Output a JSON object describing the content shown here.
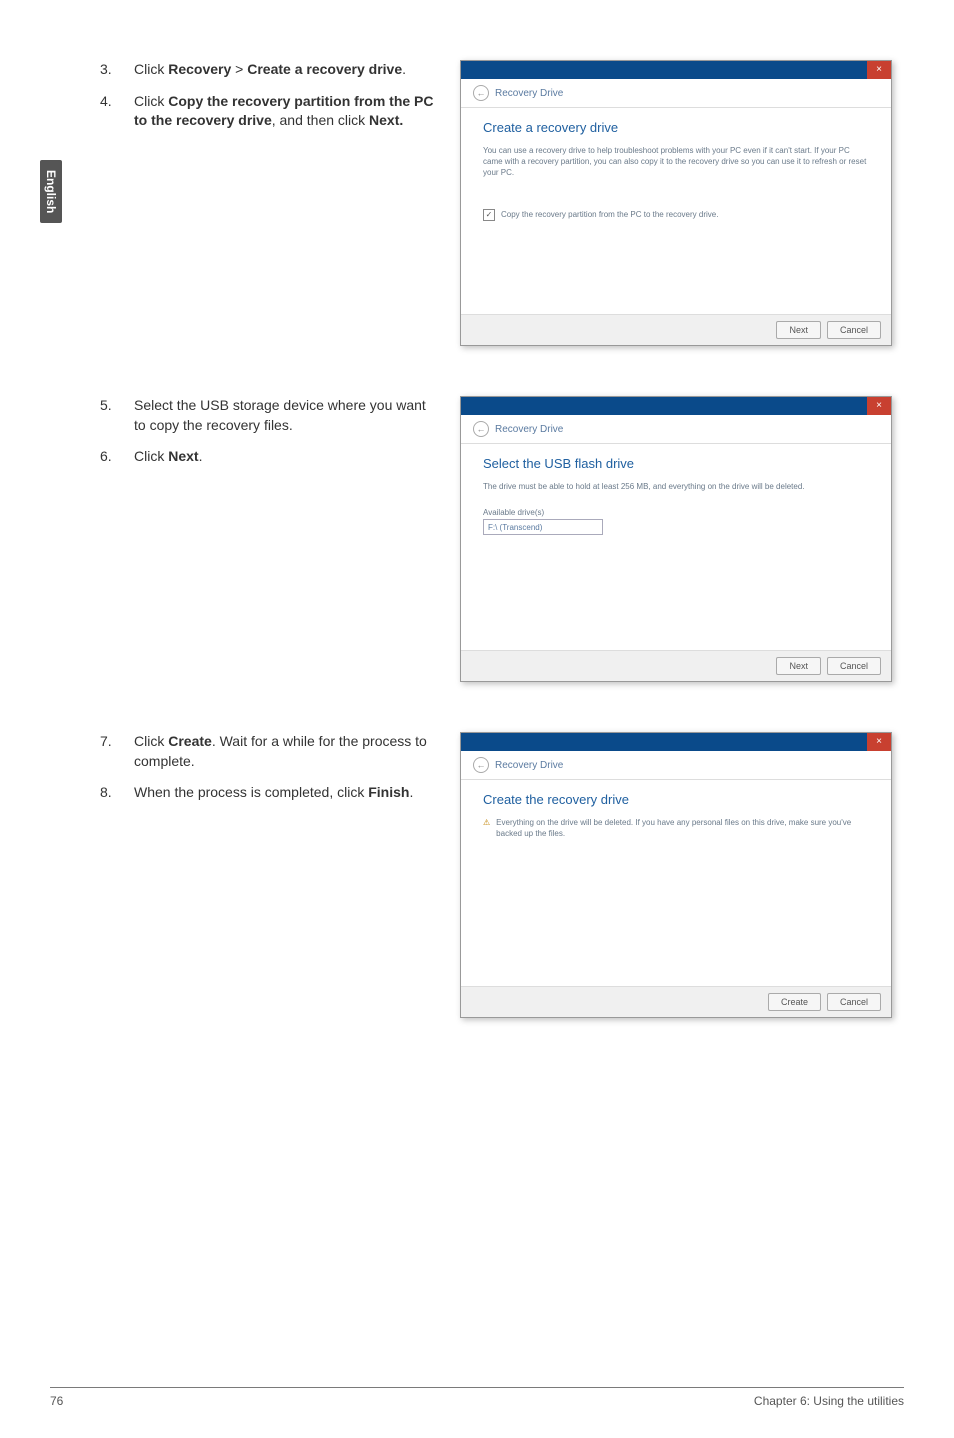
{
  "sideTab": "English",
  "section1": {
    "steps": [
      {
        "num": "3.",
        "prefix": "Click ",
        "bold": "Recovery",
        "gt": " > ",
        "bold2": "Create a recovery drive",
        "suffix": "."
      },
      {
        "num": "4.",
        "prefix": "Click ",
        "bold": "Copy the recovery partition from the PC to the recovery drive",
        "mid": ", and then click ",
        "bold2": "Next.",
        "suffix": ""
      }
    ],
    "dialog": {
      "breadcrumb_arrow": "←",
      "breadcrumb": "Recovery Drive",
      "title": "Create a recovery drive",
      "para": "You can use a recovery drive to help troubleshoot problems with your PC even if it can't start. If your PC came with a recovery partition, you can also copy it to the recovery drive so you can use it to refresh or reset your PC.",
      "checkbox_mark": "✓",
      "checkbox": "Copy the recovery partition from the PC to the recovery drive.",
      "btnNext": "Next",
      "btnCancel": "Cancel",
      "close": "×"
    }
  },
  "section2": {
    "steps": [
      {
        "num": "5.",
        "text": "Select the USB storage device where you want to copy the recovery files."
      },
      {
        "num": "6.",
        "prefix": "Click ",
        "bold": "Next",
        "suffix": "."
      }
    ],
    "dialog": {
      "breadcrumb_arrow": "←",
      "breadcrumb": "Recovery Drive",
      "title": "Select the USB flash drive",
      "para": "The drive must be able to hold at least 256 MB, and everything on the drive will be deleted.",
      "drvLabel": "Available drive(s)",
      "drvItem": "F:\\ (Transcend)",
      "btnNext": "Next",
      "btnCancel": "Cancel",
      "close": "×"
    }
  },
  "section3": {
    "steps": [
      {
        "num": "7.",
        "prefix": "Click ",
        "bold": "Create",
        "suffix": ". Wait for a while for the process to complete."
      },
      {
        "num": "8.",
        "prefix": "When the process is completed, click ",
        "bold": "Finish",
        "suffix": "."
      }
    ],
    "dialog": {
      "breadcrumb_arrow": "←",
      "breadcrumb": "Recovery Drive",
      "title": "Create the recovery drive",
      "warnIcon": "⚠",
      "para": "Everything on the drive will be deleted. If you have any personal files on this drive, make sure you've backed up the files.",
      "btnCreate": "Create",
      "btnCancel": "Cancel",
      "close": "×"
    }
  },
  "footer": {
    "pageNum": "76",
    "chapter": "Chapter 6: Using the utilities"
  }
}
